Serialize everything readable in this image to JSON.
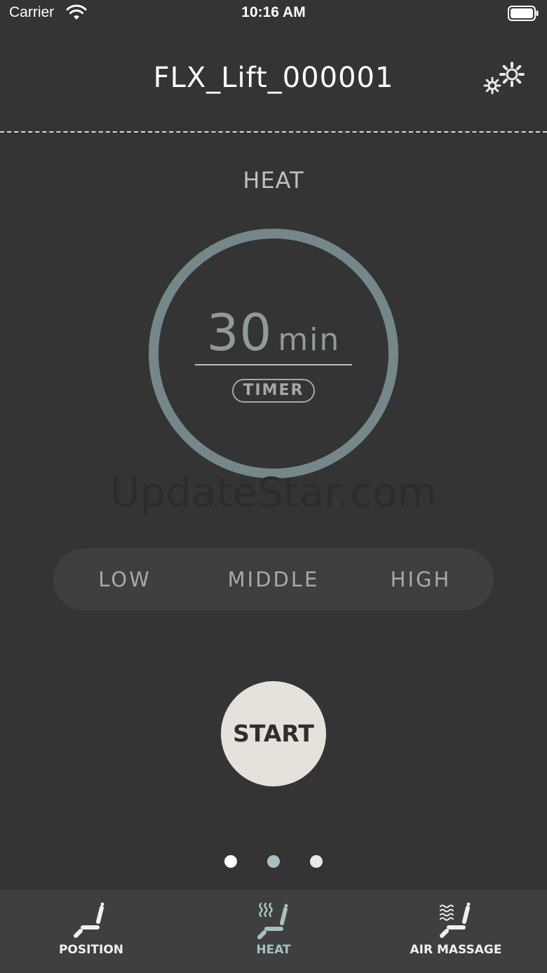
{
  "status_bar": {
    "carrier": "Carrier",
    "time": "10:16 AM",
    "wifi_icon": "wifi-icon",
    "battery_icon": "battery-icon"
  },
  "header": {
    "title": "FLX_Lift_000001",
    "settings_icon": "gear-icon"
  },
  "section": {
    "title": "HEAT"
  },
  "timer": {
    "value": "30",
    "unit": "min",
    "label": "TIMER"
  },
  "watermark": "UpdateStar.com",
  "levels": [
    {
      "label": "LOW"
    },
    {
      "label": "MIDDLE"
    },
    {
      "label": "HIGH"
    }
  ],
  "start_label": "START",
  "page_indicator": {
    "count": 3,
    "active": 2
  },
  "tabs": [
    {
      "label": "POSITION",
      "icon": "recliner-icon",
      "active": false
    },
    {
      "label": "HEAT",
      "icon": "heated-recliner-icon",
      "active": true
    },
    {
      "label": "AIR MASSAGE",
      "icon": "massage-recliner-icon",
      "active": false
    }
  ],
  "colors": {
    "background": "#343434",
    "ring": "#75878a",
    "accent": "#a7c0c2",
    "start_button": "#e7e1dc"
  }
}
